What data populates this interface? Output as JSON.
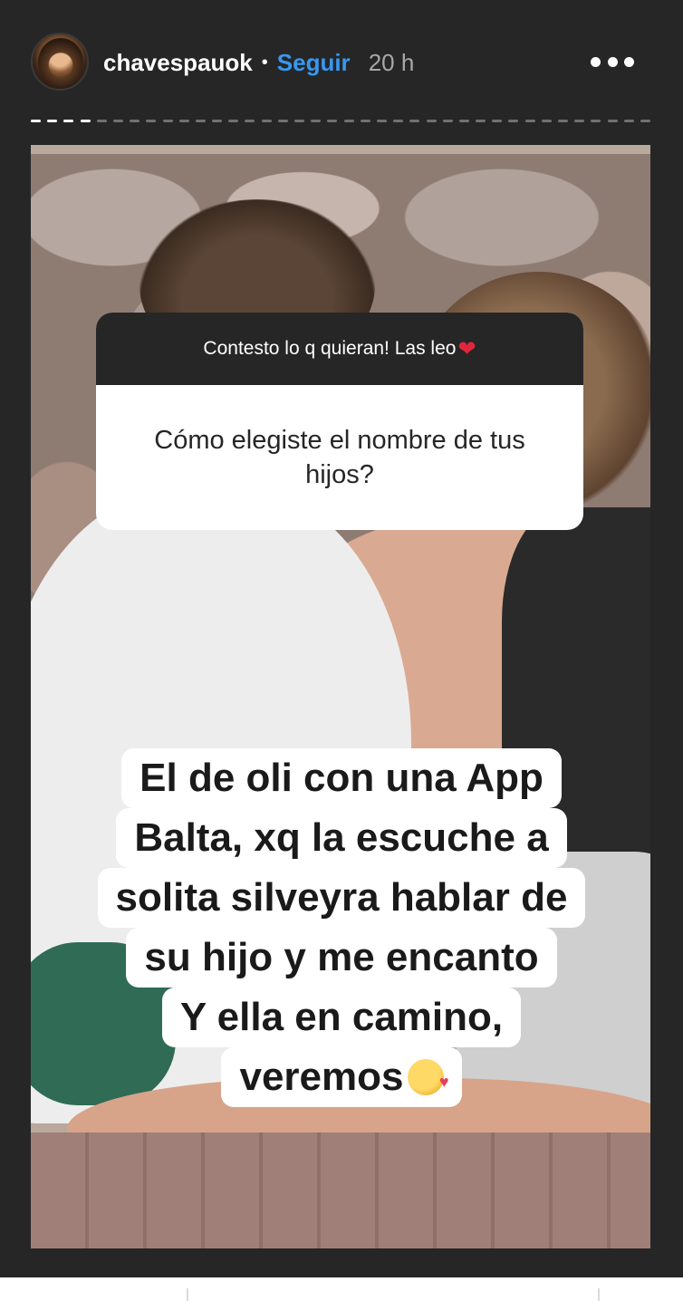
{
  "header": {
    "username": "chavespauok",
    "separator": "•",
    "follow_label": "Seguir",
    "time": "20 h",
    "more_icon": "more-horizontal-icon",
    "avatar_icon": "profile-avatar"
  },
  "progress": {
    "total_segments": 38,
    "viewed_segments": 4
  },
  "question_sticker": {
    "prompt": "Contesto lo q quieran! Las leo",
    "prompt_icon": "red-heart-emoji",
    "question": "Cómo elegiste el nombre de tus hijos?"
  },
  "answer": {
    "lines": [
      "El de oli con una App",
      "Balta, xq la escuche a",
      "solita silveyra hablar de",
      "su hijo y me encanto",
      "Y ella en camino,",
      "veremos"
    ],
    "trailing_icon": "smiling-face-with-hearts-emoji"
  },
  "colors": {
    "background": "#262626",
    "follow_blue": "#3897f0",
    "heart_red": "#e0263d"
  }
}
